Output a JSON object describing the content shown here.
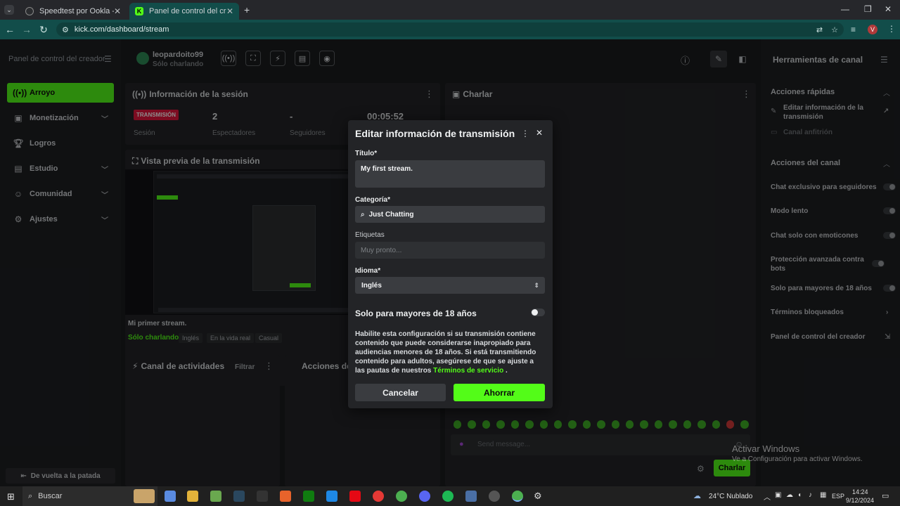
{
  "browser": {
    "tabs": [
      {
        "title": "Speedtest por Ookla - La prueb",
        "active": false
      },
      {
        "title": "Panel de control del creador | k",
        "active": true
      }
    ],
    "new_tab": "+",
    "url": "kick.com/dashboard/stream",
    "profile_initial": "V"
  },
  "sidebar": {
    "title": "Panel de control del creador",
    "items": [
      {
        "label": "Arroyo",
        "icon": "broadcast-icon",
        "active": true
      },
      {
        "label": "Monetización",
        "icon": "money-icon",
        "chevron": true
      },
      {
        "label": "Logros",
        "icon": "trophy-icon"
      },
      {
        "label": "Estudio",
        "icon": "studio-icon",
        "chevron": true
      },
      {
        "label": "Comunidad",
        "icon": "people-icon",
        "chevron": true
      },
      {
        "label": "Ajustes",
        "icon": "gear-icon",
        "chevron": true
      }
    ],
    "back_label": "De vuelta a la patada"
  },
  "header": {
    "username": "leopardoito99",
    "category": "Sólo charlando"
  },
  "session": {
    "title": "Información de la sesión",
    "badge": "TRANSMISIÓN",
    "badge_label": "Sesión",
    "viewers": "2",
    "viewers_label": "Espectadores",
    "followers": "-",
    "followers_label": "Seguidores",
    "time": "00:05:52"
  },
  "preview": {
    "title": "Vista previa de la transmisión",
    "stream_title": "Mi primer stream.",
    "category": "Sólo charlando",
    "tags": [
      "Inglés",
      "En la vida real",
      "Casual"
    ]
  },
  "activity": {
    "title": "Canal de actividades",
    "filter": "Filtrar"
  },
  "actions_panel": {
    "title": "Acciones de"
  },
  "chat": {
    "title": "Charlar",
    "placeholder": "Send message...",
    "send": "Charlar"
  },
  "rightbar": {
    "title": "Herramientas de canal",
    "quick_title": "Acciones rápidas",
    "quick_items": [
      "Editar información de la transmisión",
      "Canal anfitrión"
    ],
    "channel_title": "Acciones del canal",
    "channel_items": [
      {
        "label": "Chat exclusivo para seguidores",
        "toggle": true
      },
      {
        "label": "Modo lento",
        "toggle": true
      },
      {
        "label": "Chat solo con emoticones",
        "toggle": true
      },
      {
        "label": "Protección avanzada contra bots",
        "toggle": true
      },
      {
        "label": "Solo para mayores de 18 años",
        "toggle": true
      },
      {
        "label": "Términos bloqueados",
        "chevron": true
      },
      {
        "label": "Panel de control del creador",
        "chevron": true
      }
    ]
  },
  "modal": {
    "title": "Editar información de transmisión",
    "title_label": "Título*",
    "title_value": "My first stream.",
    "category_label": "Categoría*",
    "category_value": "Just Chatting",
    "tags_label": "Etiquetas",
    "tags_placeholder": "Muy pronto...",
    "language_label": "Idioma*",
    "language_value": "Inglés",
    "adult_label": "Solo para mayores de 18 años",
    "adult_enabled": false,
    "description": "Habilite esta configuración si su transmisión contiene contenido que puede considerarse inapropiado para audiencias menores de 18 años. Si está transmitiendo contenido para adultos, asegúrese de que se ajuste a las pautas de nuestros",
    "terms_link": "Términos de servicio",
    "terms_end": " .",
    "cancel": "Cancelar",
    "save": "Ahorrar"
  },
  "watermark": {
    "title": "Activar Windows",
    "subtitle": "Ve a Configuración para activar Windows."
  },
  "taskbar": {
    "search": "Buscar",
    "weather": "24°C  Nublado",
    "lang": "ESP",
    "time": "14:24",
    "date": "9/12/2024"
  },
  "colors": {
    "accent": "#53fc18",
    "badge": "#e2173d",
    "bg": "#1b1c1e",
    "panel": "#232427"
  }
}
